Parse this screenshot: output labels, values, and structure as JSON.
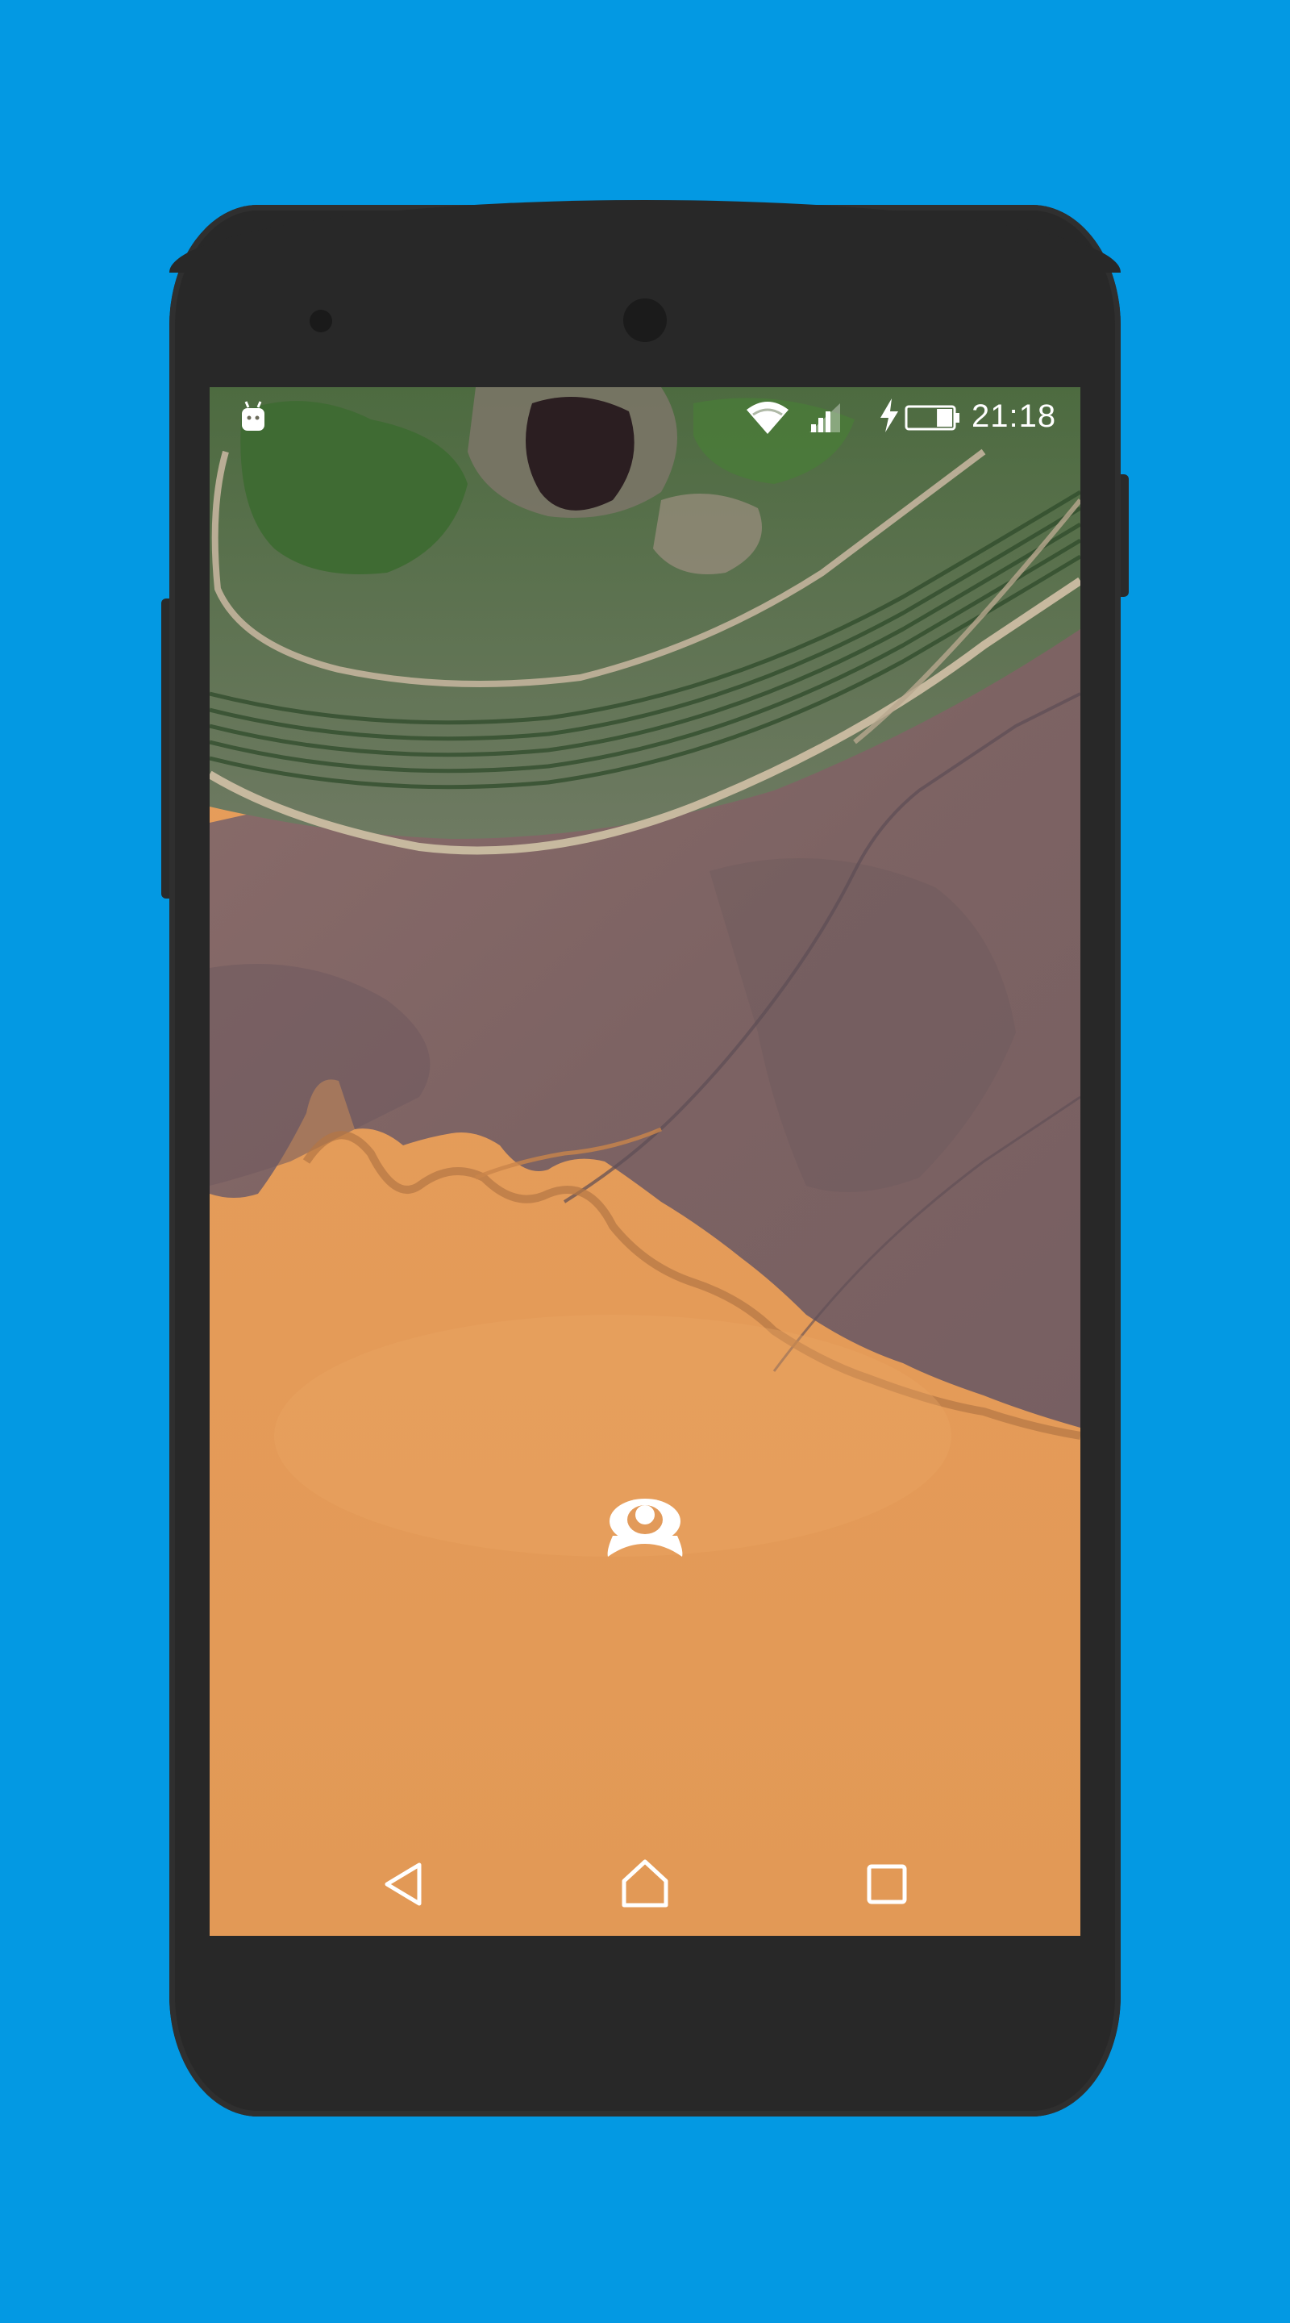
{
  "status_bar": {
    "time": "21:18",
    "icons": [
      "android-debug-icon",
      "wifi-icon",
      "cell-signal-icon",
      "charging-bolt-icon",
      "battery-icon"
    ],
    "battery_level": 0.35
  },
  "home_screen": {
    "center_icon": "launcher-logo-icon"
  },
  "nav_bar": {
    "buttons": [
      "back-icon",
      "home-icon",
      "recents-icon"
    ]
  },
  "colors": {
    "background": "#0399e3",
    "phone_body": "#282828",
    "status_text": "#ffffff"
  }
}
